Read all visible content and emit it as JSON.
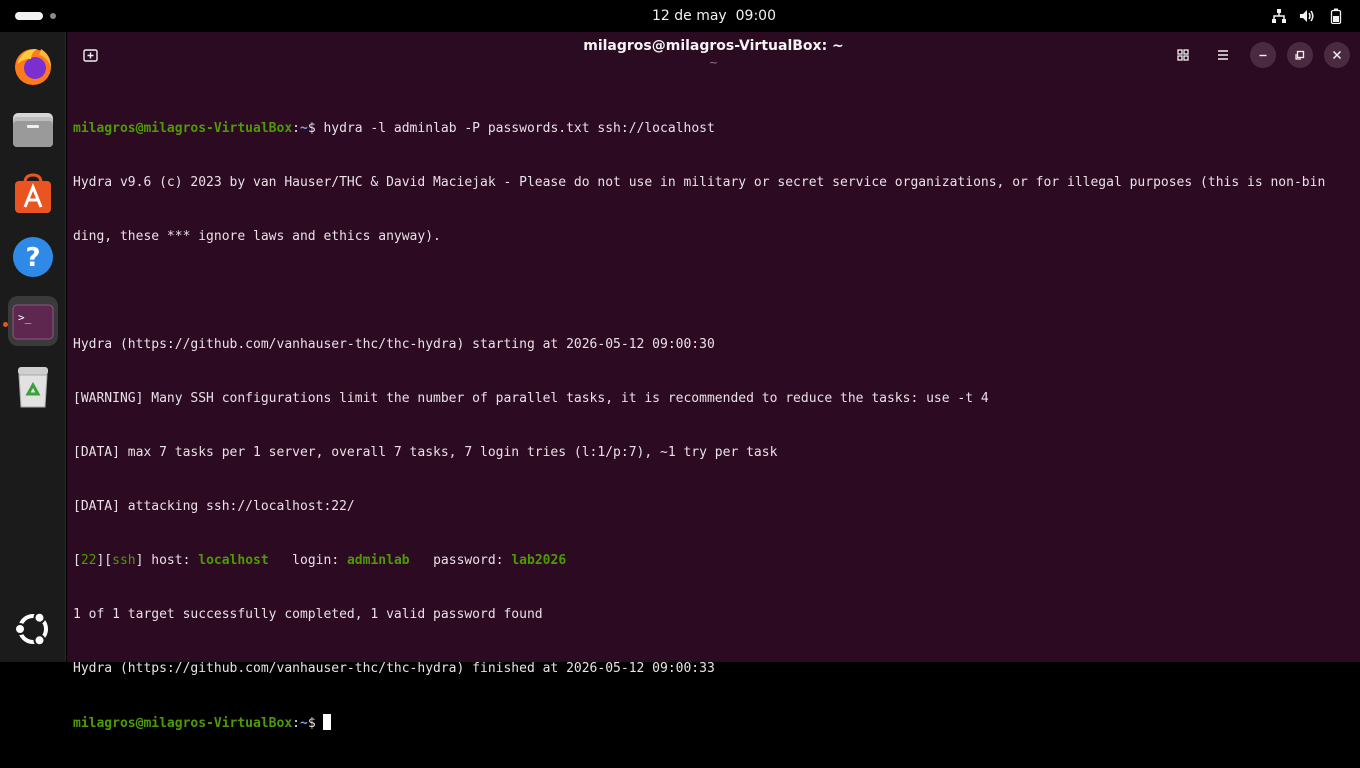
{
  "topbar": {
    "date": "12 de may",
    "time": "09:00"
  },
  "window": {
    "title": "milagros@milagros-VirtualBox: ~",
    "subtitle": "~"
  },
  "terminal": {
    "prompt_user": "milagros@milagros-VirtualBox",
    "prompt_sep": ":",
    "prompt_path": "~",
    "prompt_symbol": "$",
    "command": " hydra -l adminlab -P passwords.txt ssh://localhost",
    "output": [
      "Hydra v9.6 (c) 2023 by van Hauser/THC & David Maciejak - Please do not use in military or secret service organizations, or for illegal purposes (this is non-bin",
      "ding, these *** ignore laws and ethics anyway).",
      "",
      "Hydra (https://github.com/vanhauser-thc/thc-hydra) starting at 2026-05-12 09:00:30",
      "[WARNING] Many SSH configurations limit the number of parallel tasks, it is recommended to reduce the tasks: use -t 4",
      "[DATA] max 7 tasks per 1 server, overall 7 tasks, 7 login tries (l:1/p:7), ~1 try per task",
      "[DATA] attacking ssh://localhost:22/"
    ],
    "result": {
      "port": "22",
      "service": "ssh",
      "host_label": " host: ",
      "host": "localhost",
      "login_label": "   login: ",
      "login": "adminlab",
      "password_label": "   password: ",
      "password": "lab2026"
    },
    "output_after": [
      "1 of 1 target successfully completed, 1 valid password found",
      "Hydra (https://github.com/vanhauser-thc/thc-hydra) finished at 2026-05-12 09:00:33"
    ]
  },
  "colors": {
    "terminal_bg": "#2c0a22",
    "prompt_green": "#4e9a06",
    "path_blue": "#7f9ee7",
    "accent": "#e95420"
  }
}
